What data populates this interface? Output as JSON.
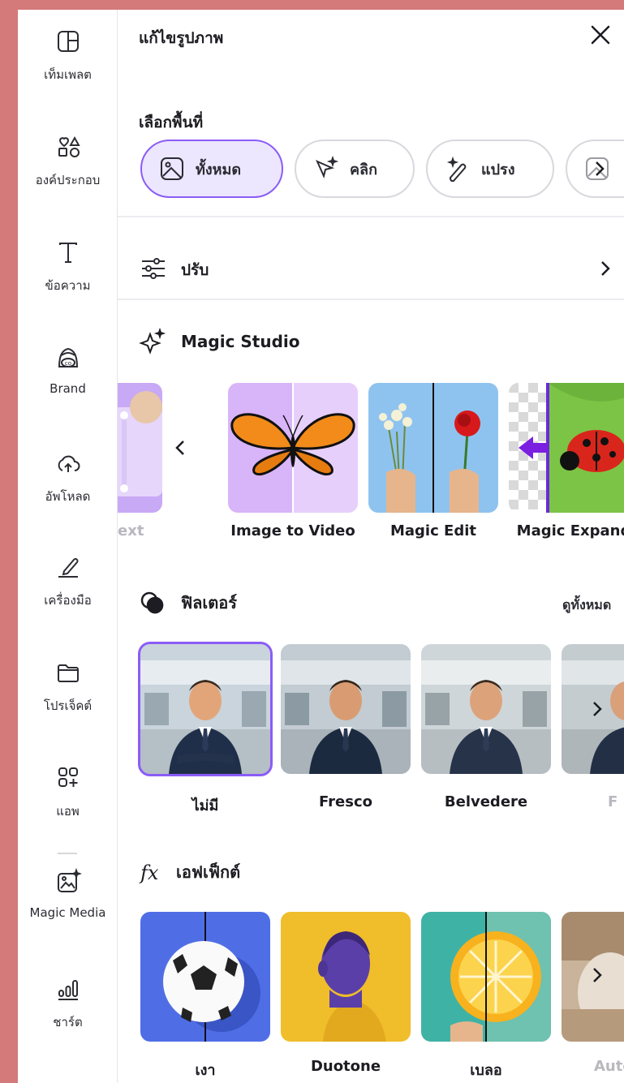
{
  "rail": {
    "items": [
      {
        "label": "เท็มเพลต",
        "icon": "template-icon"
      },
      {
        "label": "องค์ประกอบ",
        "icon": "elements-icon"
      },
      {
        "label": "ข้อความ",
        "icon": "text-icon"
      },
      {
        "label": "Brand",
        "icon": "brand-icon"
      },
      {
        "label": "อัพโหลด",
        "icon": "upload-icon"
      },
      {
        "label": "เครื่องมือ",
        "icon": "draw-icon"
      },
      {
        "label": "โปรเจ็คต์",
        "icon": "folder-icon"
      },
      {
        "label": "แอพ",
        "icon": "apps-icon"
      },
      {
        "label": "Magic Media",
        "icon": "magic-media-icon"
      },
      {
        "label": "ชาร์ต",
        "icon": "chart-icon"
      }
    ]
  },
  "panel": {
    "title": "แก้ไขรูปภาพ",
    "select_area_title": "เลือกพื้นที่",
    "select_modes": [
      "ทั้งหมด",
      "คลิก",
      "แปรง"
    ],
    "adjust_label": "ปรับ",
    "magic_studio": {
      "title": "Magic Studio",
      "items": [
        "ext",
        "Image to Video",
        "Magic Edit",
        "Magic Expand"
      ]
    },
    "filters": {
      "title": "ฟิลเตอร์",
      "see_all": "ดูทั้งหมด",
      "items": [
        "ไม่มี",
        "Fresco",
        "Belvedere",
        "F"
      ]
    },
    "effects": {
      "title": "เอฟเฟ็กต์",
      "items": [
        "เงา",
        "Duotone",
        "เบลอ",
        "Auto"
      ]
    }
  },
  "colors": {
    "accent": "#8b5cf6",
    "active_pill_bg": "#ece7ff",
    "background_frame": "#d47a7a"
  }
}
